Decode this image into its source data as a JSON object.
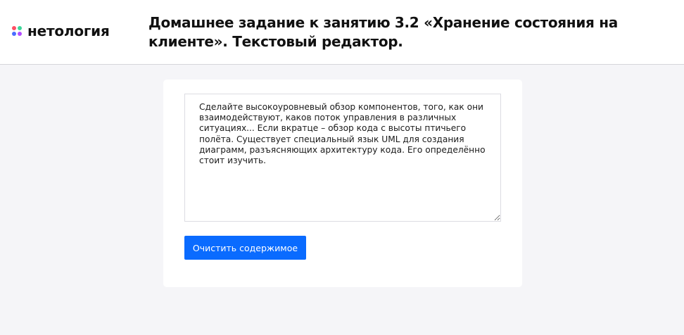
{
  "header": {
    "logo_text": "нетология",
    "title": "Домашнее задание к занятию 3.2 «Хранение состояния на клиенте». Текстовый редактор."
  },
  "editor": {
    "value": "Сделайте высокоуровневый обзор компонентов, того, как они взаимодействуют, каков поток управления в различных ситуациях... Если вкратце – обзор кода с высоты птичьего полёта. Существует специальный язык UML для создания диаграмм, разъясняющих архитектуру кода. Его определённо стоит изучить."
  },
  "actions": {
    "clear_label": "Очистить содержимое"
  },
  "colors": {
    "accent": "#0a6bff",
    "background": "#f5f5f8",
    "logo_dots": [
      "#ff4f64",
      "#3dd79a",
      "#4a6cff",
      "#b24dff"
    ]
  }
}
